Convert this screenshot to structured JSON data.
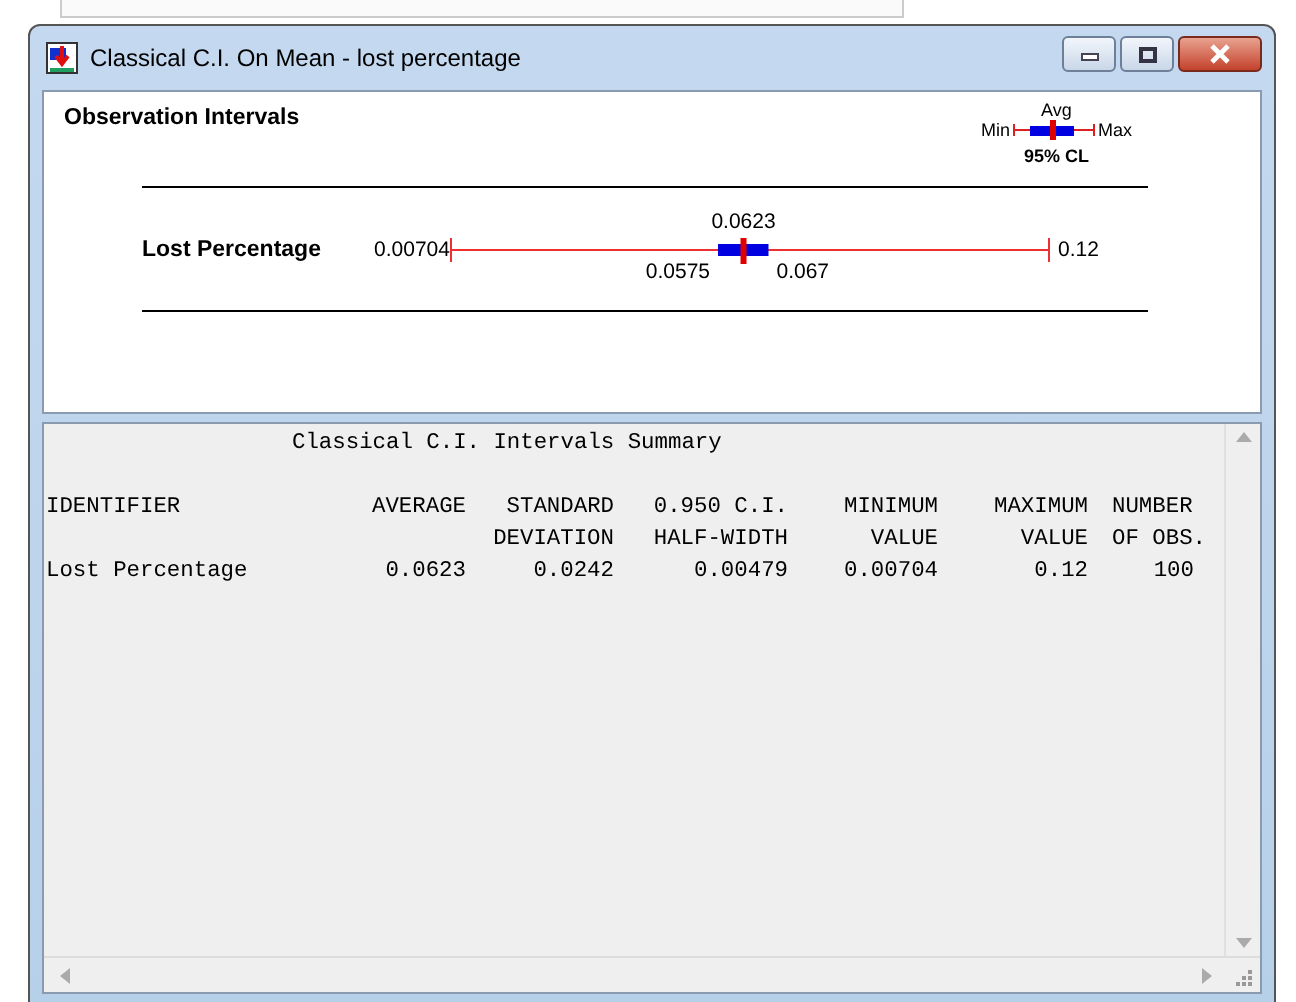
{
  "window": {
    "title": "Classical C.I. On Mean - lost percentage"
  },
  "observation_panel": {
    "title": "Observation Intervals",
    "legend": {
      "avg": "Avg",
      "min": "Min",
      "max": "Max",
      "cl": "95% CL"
    },
    "rows": [
      {
        "label": "Lost Percentage",
        "min": "0.00704",
        "lower": "0.0575",
        "avg": "0.0623",
        "upper": "0.067",
        "max": "0.12"
      }
    ]
  },
  "summary": {
    "title": "Classical C.I. Intervals Summary",
    "columns": [
      {
        "lines": [
          "IDENTIFIER"
        ]
      },
      {
        "lines": [
          "AVERAGE"
        ]
      },
      {
        "lines": [
          "STANDARD",
          "DEVIATION"
        ]
      },
      {
        "lines": [
          "0.950 C.I.",
          "HALF-WIDTH"
        ]
      },
      {
        "lines": [
          "MINIMUM",
          "VALUE"
        ]
      },
      {
        "lines": [
          "MAXIMUM",
          "VALUE"
        ]
      },
      {
        "lines": [
          "NUMBER",
          "OF OBS."
        ]
      }
    ],
    "rows": [
      {
        "cells": [
          "Lost Percentage",
          "0.0623",
          "0.0242",
          "0.00479",
          "0.00704",
          "0.12",
          "100"
        ]
      }
    ]
  }
}
